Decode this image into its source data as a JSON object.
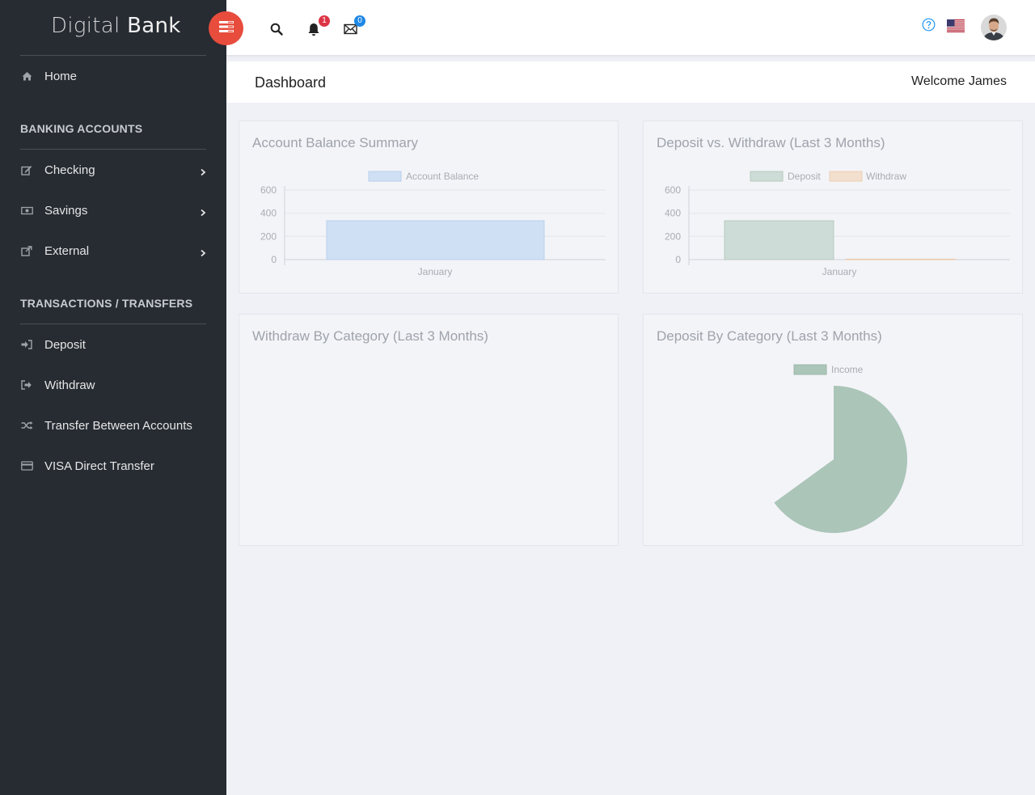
{
  "brand": {
    "light": "Digital",
    "bold": "Bank"
  },
  "sidebar": {
    "home": "Home",
    "sections": [
      {
        "title": "BANKING ACCOUNTS"
      },
      {
        "title": "TRANSACTIONS / TRANSFERS"
      }
    ],
    "accounts": [
      "Checking",
      "Savings",
      "External"
    ],
    "transactions": [
      "Deposit",
      "Withdraw",
      "Transfer Between Accounts",
      "VISA Direct Transfer"
    ]
  },
  "topbar": {
    "notifications_count": "1",
    "messages_count": "0"
  },
  "page": {
    "title": "Dashboard",
    "welcome": "Welcome James"
  },
  "colors": {
    "sidebar_bg": "#272c33",
    "menu_toggle": "#e74c3c",
    "balance_bar": "#cfe0f5",
    "deposit_bar": "#cddcd6",
    "withdraw_bar": "#f3dfcd",
    "income_slice": "#abc5b9"
  },
  "cards": {
    "balance": {
      "title": "Account Balance Summary"
    },
    "deposit_withdraw": {
      "title": "Deposit vs. Withdraw (Last 3 Months)"
    },
    "withdraw_category": {
      "title": "Withdraw By Category (Last 3 Months)"
    },
    "deposit_category": {
      "title": "Deposit By Category (Last 3 Months)"
    }
  },
  "chart_data": [
    {
      "type": "bar",
      "title": "Account Balance Summary",
      "categories": [
        "January"
      ],
      "series": [
        {
          "name": "Account Balance",
          "values": [
            335
          ]
        }
      ],
      "ylim": [
        0,
        600
      ],
      "yticks": [
        0,
        200,
        400,
        600
      ],
      "legend": "top",
      "grid": true
    },
    {
      "type": "bar",
      "title": "Deposit vs. Withdraw (Last 3 Months)",
      "categories": [
        "January"
      ],
      "series": [
        {
          "name": "Deposit",
          "values": [
            335
          ]
        },
        {
          "name": "Withdraw",
          "values": [
            5
          ]
        }
      ],
      "ylim": [
        0,
        600
      ],
      "yticks": [
        0,
        200,
        400,
        600
      ],
      "legend": "top",
      "grid": true
    },
    {
      "type": "pie",
      "title": "Deposit By Category (Last 3 Months)",
      "categories": [
        "Income"
      ],
      "series": [
        {
          "name": "Income",
          "values": [
            100
          ]
        }
      ],
      "shown_fraction": 0.65,
      "legend": "top"
    }
  ]
}
